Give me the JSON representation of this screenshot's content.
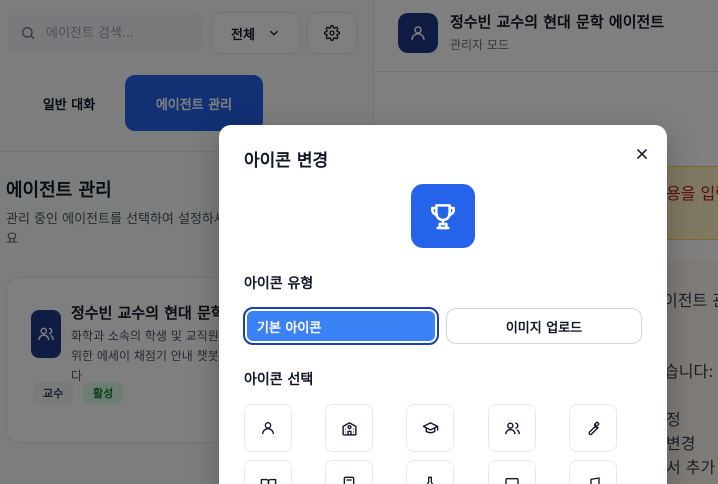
{
  "sidebar": {
    "search": {
      "placeholder": "에이전트 검색..."
    },
    "filter": {
      "selected": "전체"
    },
    "tabs": [
      {
        "label": "일반 대화",
        "active": false
      },
      {
        "label": "에이전트 관리",
        "active": true
      }
    ],
    "section": {
      "title": "에이전트 관리",
      "description": "관리 중인 에이전트를 선택하여 설정하세요"
    },
    "agent_card": {
      "name": "정수빈 교수의 현대 문학",
      "description": "화학과 소속의 학생 및 교직원을 위한 에세이 채점기 안내 챗봇입니다",
      "badges": {
        "role": "교수",
        "status": "활성"
      }
    }
  },
  "main": {
    "header": {
      "title": "정수빈 교수의 현대 문학 에이전트",
      "subtitle": "관리자 모드"
    },
    "warning_text": "용을 입력",
    "chat_lines": [
      "이전트 관",
      "습니다:",
      "정",
      "변경",
      "서 추가",
      "결"
    ]
  },
  "modal": {
    "title": "아이콘 변경",
    "preview_icon": "trophy-icon",
    "type_label": "아이콘 유형",
    "type_options": [
      {
        "label": "기본 아이콘",
        "selected": true
      },
      {
        "label": "이미지 업로드",
        "selected": false
      }
    ],
    "select_label": "아이콘 선택",
    "icons": [
      "user-icon",
      "school-icon",
      "graduation-cap-icon",
      "users-icon",
      "wrench-icon",
      "book-icon",
      "calculator-icon",
      "flask-icon",
      "monitor-icon",
      "music-icon"
    ]
  },
  "colors": {
    "accent": "#2563eb",
    "accent_dark": "#1e3a8a",
    "overlay": "rgba(0,0,0,0.5)"
  }
}
